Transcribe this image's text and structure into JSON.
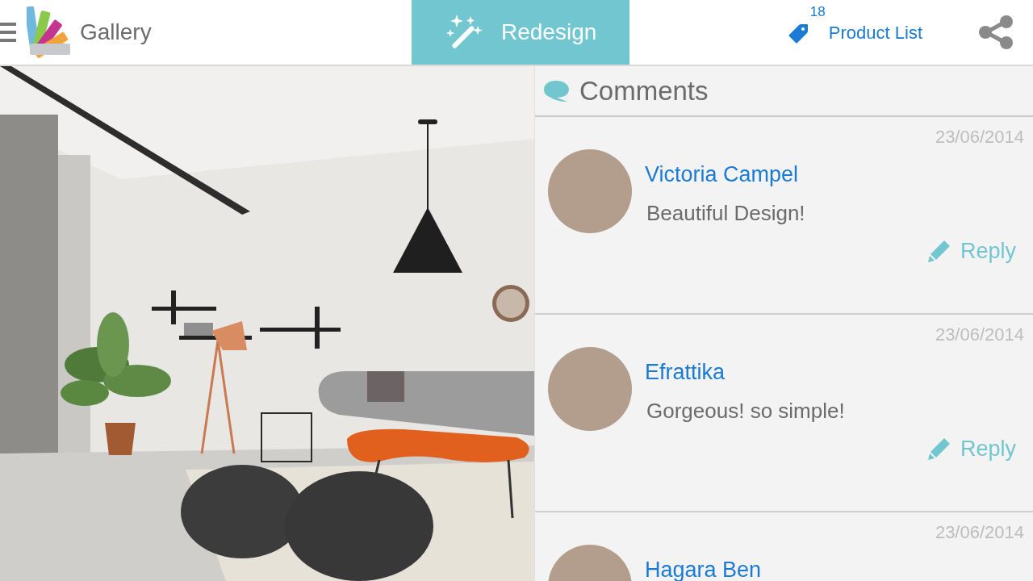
{
  "header": {
    "title": "Gallery",
    "redesign_button": "Redesign",
    "product_list": {
      "count": "18",
      "label": "Product List"
    }
  },
  "comments": {
    "title": "Comments",
    "items": [
      {
        "date": "23/06/2014",
        "author": "Victoria Campel",
        "text": "Beautiful Design!",
        "reply": "Reply"
      },
      {
        "date": "23/06/2014",
        "author": "Efrattika",
        "text": "Gorgeous! so simple!",
        "reply": "Reply"
      },
      {
        "date": "23/06/2014",
        "author": "Hagara Ben"
      }
    ]
  }
}
